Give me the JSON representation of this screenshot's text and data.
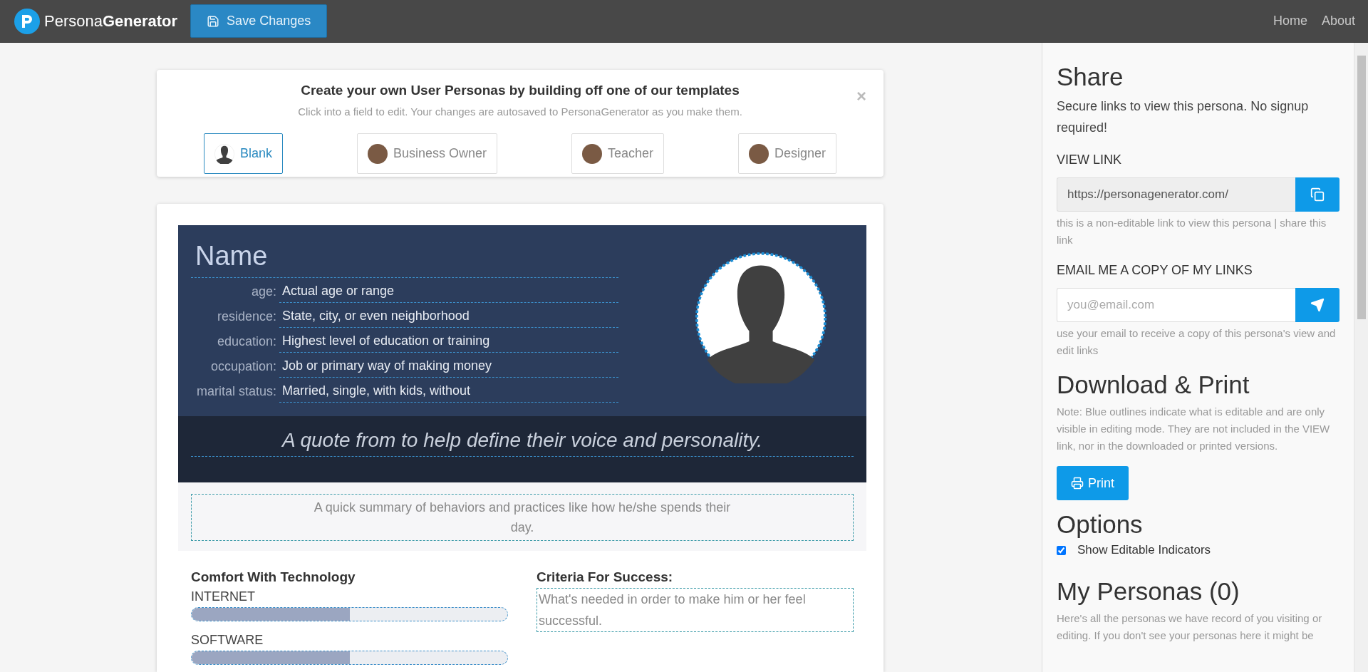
{
  "header": {
    "logo": "Persona**Generator**",
    "save_button": "Save Changes",
    "nav": [
      "Home",
      "About"
    ]
  },
  "templates": {
    "title": "Create your own User Personas by building off one of our templates",
    "subtitle": "Click into a field to edit. Your changes are autosaved to PersonaGenerator as you make them.",
    "close": "×",
    "items": [
      {
        "label": "Blank",
        "kind": "silhouette",
        "selected": true
      },
      {
        "label": "Business Owner",
        "kind": "photo",
        "selected": false
      },
      {
        "label": "Teacher",
        "kind": "photo",
        "selected": false
      },
      {
        "label": "Designer",
        "kind": "photo",
        "selected": false
      }
    ]
  },
  "persona": {
    "name": "Name",
    "fields": [
      {
        "label": "age:",
        "value": "Actual age or range"
      },
      {
        "label": "residence:",
        "value": "State, city, or even neighborhood"
      },
      {
        "label": "education:",
        "value": "Highest level of education or training"
      },
      {
        "label": "occupation:",
        "value": "Job or primary way of making money"
      },
      {
        "label": "marital status:",
        "value": "Married, single, with kids, without"
      }
    ],
    "quote": "A quote from to help define their voice and personality.",
    "summary": "A quick summary of behaviors and practices like how he/she spends their day.",
    "tech_title": "Comfort With Technology",
    "tech": [
      {
        "label": "INTERNET",
        "level": 0.5
      },
      {
        "label": "SOFTWARE",
        "level": 0.5
      }
    ],
    "criteria_title": "Criteria For Success:",
    "criteria": "What's needed in order to make him or her feel successful."
  },
  "sidebar": {
    "share_title": "Share",
    "share_text": "Secure links to view this persona. No signup required!",
    "view_link_label": "VIEW LINK",
    "view_link": "https://personagenerator.com/",
    "view_link_help": "this is a non-editable link to view this persona | share this link",
    "email_label": "EMAIL ME A COPY OF MY LINKS",
    "email_placeholder": "you@email.com",
    "email_help": "use your email to receive a copy of this persona's view and edit links",
    "download_title": "Download & Print",
    "download_note": "Note: Blue outlines indicate what is editable and are only visible in editing mode. They are not included in the VIEW link, nor in the downloaded or printed versions.",
    "print_button": "Print",
    "options_title": "Options",
    "options": [
      {
        "label": "Show Editable Indicators",
        "checked": true
      }
    ],
    "my_personas_title": "My Personas (0)",
    "my_personas_text": "Here's all the personas we have record of you visiting or editing. If you don't see your personas here it might be"
  }
}
